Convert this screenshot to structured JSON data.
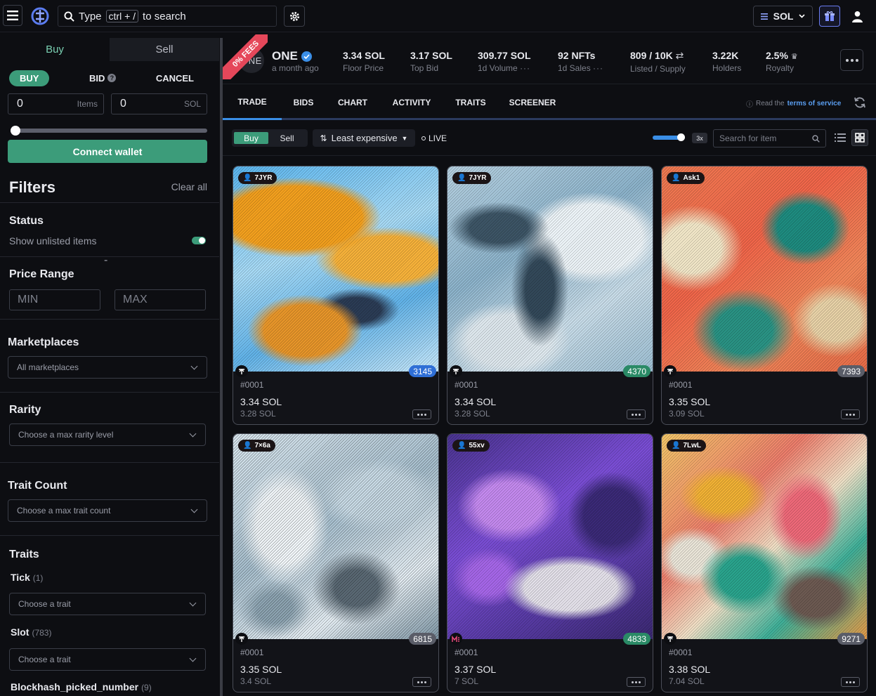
{
  "topbar": {
    "search": {
      "prefix": "Type",
      "key": "ctrl + /",
      "suffix": "to search"
    },
    "currency": "SOL",
    "icons": [
      "hamburger-menu-icon",
      "logo",
      "search-icon",
      "gear-icon",
      "gift-icon",
      "user-icon"
    ]
  },
  "sidebar": {
    "tabs": {
      "buy": "Buy",
      "sell": "Sell"
    },
    "modes": {
      "buy": "BUY",
      "bid": "BID",
      "cancel": "CANCEL"
    },
    "items_input": {
      "value": "0",
      "unit": "Items"
    },
    "sol_input": {
      "value": "0",
      "unit": "SOL"
    },
    "connect_wallet": "Connect wallet",
    "filters_title": "Filters",
    "clear_all": "Clear all",
    "status": {
      "title": "Status",
      "unlisted_label": "Show unlisted items",
      "unlisted_on": true
    },
    "price_range": {
      "title": "Price Range",
      "min_placeholder": "MIN",
      "max_placeholder": "MAX",
      "separator": "-"
    },
    "marketplaces": {
      "title": "Marketplaces",
      "value": "All marketplaces"
    },
    "rarity": {
      "title": "Rarity",
      "placeholder": "Choose a max rarity level"
    },
    "trait_count": {
      "title": "Trait Count",
      "placeholder": "Choose a max trait count"
    },
    "traits": {
      "title": "Traits",
      "items": [
        {
          "name": "Tick",
          "count": "(1)",
          "placeholder": "Choose a trait"
        },
        {
          "name": "Slot",
          "count": "(783)",
          "placeholder": "Choose a trait"
        },
        {
          "name": "Blockhash_picked_number",
          "count": "(9)"
        }
      ]
    }
  },
  "collection": {
    "ribbon": "0% FEES",
    "avatar_text": "ONE",
    "name": "ONE",
    "age": "a month ago",
    "stats": [
      {
        "value": "3.34 SOL",
        "label": "Floor Price"
      },
      {
        "value": "3.17 SOL",
        "label": "Top Bid"
      },
      {
        "value": "309.77 SOL",
        "label": "1d Volume"
      },
      {
        "value": "92 NFTs",
        "label": "1d Sales"
      },
      {
        "value": "809 / 10K",
        "label": "Listed / Supply"
      },
      {
        "value": "3.22K",
        "label": "Holders"
      },
      {
        "value": "2.5%",
        "label": "Royalty"
      }
    ]
  },
  "nav": {
    "tabs": [
      "TRADE",
      "BIDS",
      "CHART",
      "ACTIVITY",
      "TRAITS",
      "SCREENER"
    ],
    "active": "TRADE",
    "tos_prefix": "Read the",
    "tos_link": "terms of service"
  },
  "toolbar": {
    "buy": "Buy",
    "sell": "Sell",
    "sort": "Least expensive",
    "live": "LIVE",
    "zoom": "3x",
    "search_placeholder": "Search for item"
  },
  "cards": [
    {
      "owner": "7JYR",
      "rank": "3145",
      "rank_color": "#2f6fd6",
      "id": "#0001",
      "price": "3.34 SOL",
      "last": "3.28 SOL",
      "marketplace": "tensor"
    },
    {
      "owner": "7JYR",
      "rank": "4370",
      "rank_color": "#2a8a66",
      "id": "#0001",
      "price": "3.34 SOL",
      "last": "3.28 SOL",
      "marketplace": "tensor"
    },
    {
      "owner": "Ask1",
      "rank": "7393",
      "rank_color": "#5a5d68",
      "id": "#0001",
      "price": "3.35 SOL",
      "last": "3.09 SOL",
      "marketplace": "tensor"
    },
    {
      "owner": "7×6a",
      "rank": "6815",
      "rank_color": "#5a5d68",
      "id": "#0001",
      "price": "3.35 SOL",
      "last": "3.4 SOL",
      "marketplace": "tensor"
    },
    {
      "owner": "55xv",
      "rank": "4833",
      "rank_color": "#2a8a66",
      "id": "#0001",
      "price": "3.37 SOL",
      "last": "7 SOL",
      "marketplace": "magiceden"
    },
    {
      "owner": "7LwL",
      "rank": "9271",
      "rank_color": "#5a5d68",
      "id": "#0001",
      "price": "3.38 SOL",
      "last": "7.04 SOL",
      "marketplace": "tensor"
    }
  ]
}
